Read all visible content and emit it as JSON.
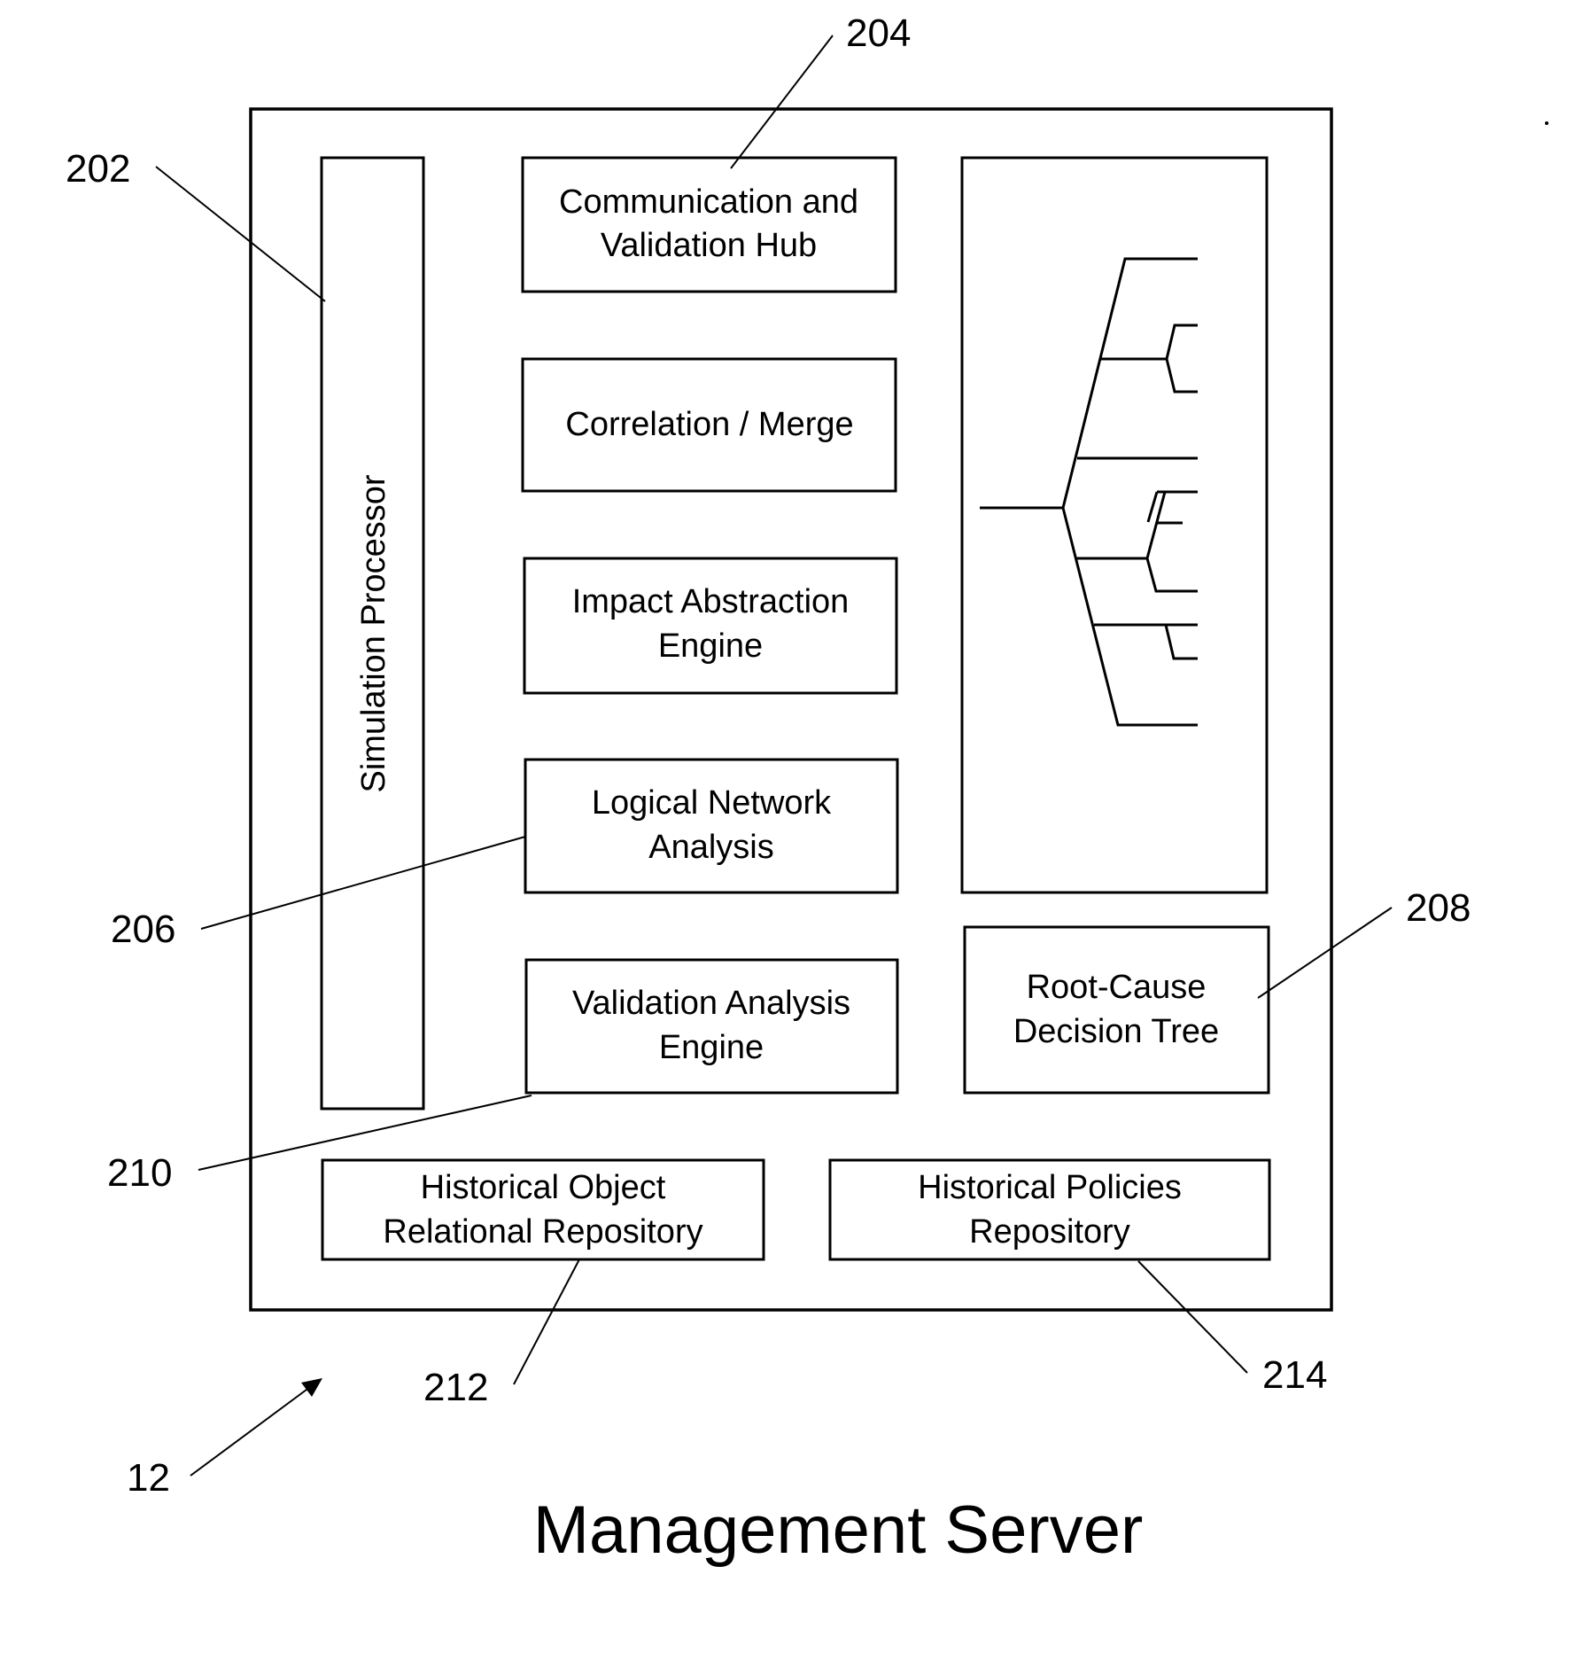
{
  "figure": {
    "title": "Management Server",
    "figure_ref": "12"
  },
  "components": {
    "simulation_processor": {
      "label": "Simulation Processor",
      "ref": "202"
    },
    "comm_hub": {
      "lines": [
        "Communication and",
        "Validation Hub"
      ],
      "ref": "204"
    },
    "correlation_merge": {
      "lines": [
        "Correlation / Merge"
      ]
    },
    "impact_abstraction": {
      "lines": [
        "Impact Abstraction",
        "Engine"
      ]
    },
    "logical_network": {
      "lines": [
        "Logical Network",
        "Analysis"
      ],
      "ref": "206"
    },
    "validation_analysis": {
      "lines": [
        "Validation Analysis",
        "Engine"
      ],
      "ref": "210"
    },
    "root_cause": {
      "lines": [
        "Root-Cause",
        "Decision Tree"
      ],
      "ref": "208"
    },
    "historical_object": {
      "lines": [
        "Historical Object",
        "Relational Repository"
      ],
      "ref": "212"
    },
    "historical_policies": {
      "lines": [
        "Historical Policies",
        "Repository"
      ],
      "ref": "214"
    }
  },
  "decision_tree": {
    "description": "decision tree illustration",
    "root_branches": 6
  }
}
